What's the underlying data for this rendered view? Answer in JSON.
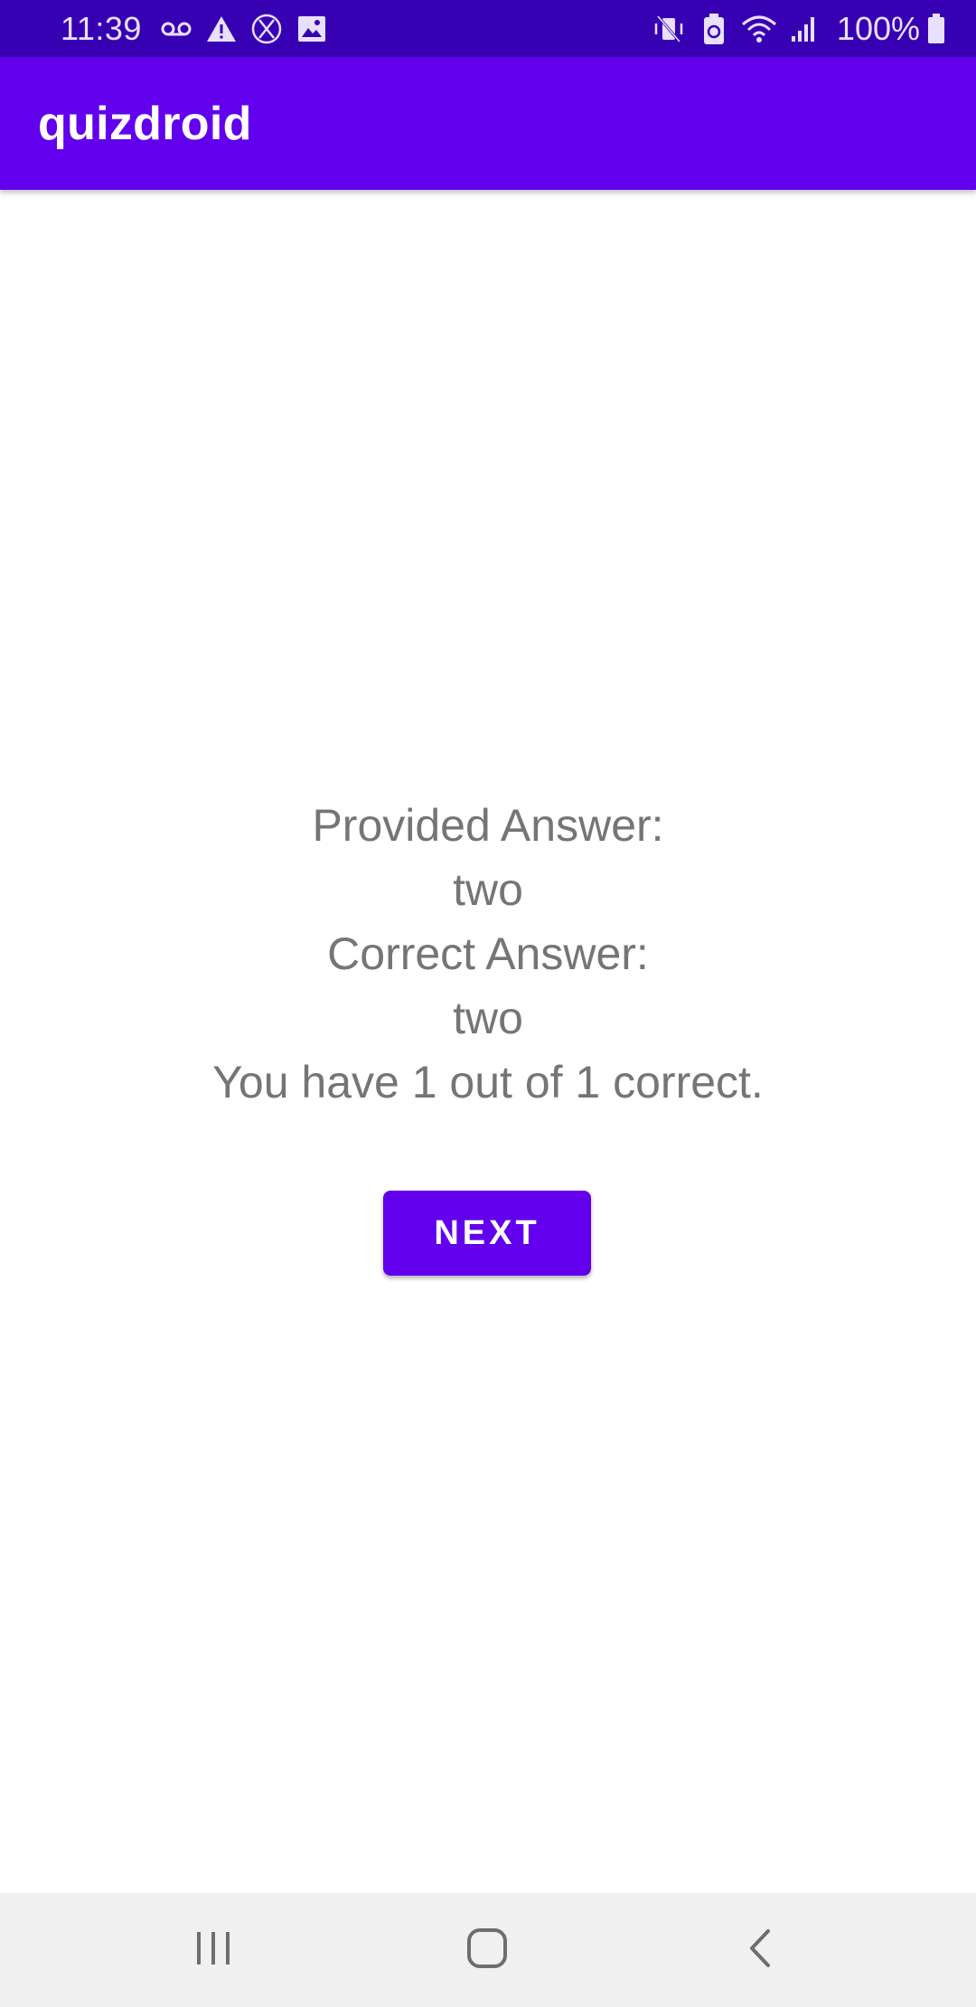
{
  "status_bar": {
    "time": "11:39",
    "battery_percent": "100%",
    "icons_left": [
      "voicemail-icon",
      "warning-icon",
      "x-circle-icon",
      "image-icon"
    ],
    "icons_right": [
      "vibrate-icon",
      "battery-saver-icon",
      "wifi-icon",
      "signal-icon",
      "battery-icon"
    ],
    "background_color": "#3700B3"
  },
  "app_bar": {
    "title": "quizdroid",
    "background_color": "#6200EE"
  },
  "result": {
    "provided_label": "Provided Answer:",
    "provided_value": "two",
    "correct_label": "Correct Answer:",
    "correct_value": "two",
    "score_text": "You have 1 out of 1 correct."
  },
  "actions": {
    "next_label": "NEXT",
    "accent_color": "#6200EE"
  },
  "nav_bar": {
    "buttons": [
      "recent-apps-icon",
      "home-icon",
      "back-icon"
    ]
  }
}
